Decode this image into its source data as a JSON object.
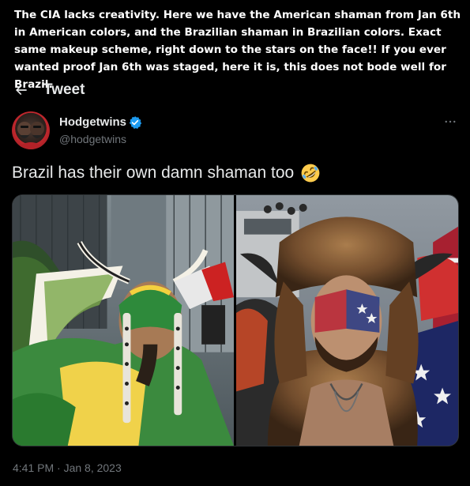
{
  "meme": {
    "caption": "The CIA lacks creativity.  Here we have the American shaman from Jan 6th in American colors, and the Brazilian shaman in Brazilian colors.  Exact same makeup scheme, right down to the stars on the face!!  If you ever wanted proof Jan 6th was staged, here it is, this does not bode well for Brazil."
  },
  "header": {
    "title": "Tweet",
    "back_icon": "arrow-left-icon"
  },
  "tweet": {
    "author": {
      "name": "Hodgetwins",
      "handle": "@hodgetwins",
      "verified": true
    },
    "text": "Brazil has their own damn shaman too",
    "emoji": "rolling-on-floor-laughing-icon",
    "media": [
      "brazil-shaman-photo",
      "jan6-shaman-photo"
    ],
    "timestamp": "4:41 PM · Jan 8, 2023"
  },
  "colors": {
    "background": "#000000",
    "text": "#e7e9ea",
    "muted": "#71767b",
    "verified": "#1d9bf0"
  }
}
